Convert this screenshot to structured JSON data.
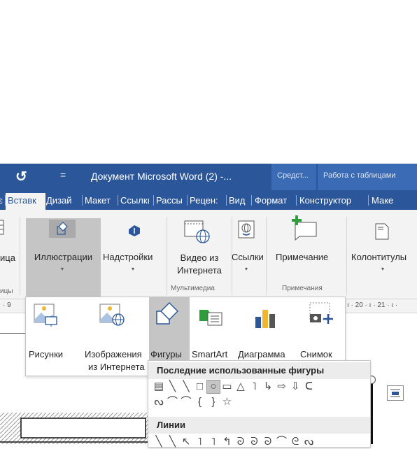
{
  "title_bar": {
    "undo_glyph": "↺",
    "qat_glyph": "=",
    "doc_title": "Документ Microsoft Word (2) -...",
    "ctx_tools": "Средст...",
    "ctx_tables": "Работа с таблицами"
  },
  "tabs": [
    {
      "label": "Вставк"
    },
    {
      "label": "Дизай"
    },
    {
      "label": "Макет"
    },
    {
      "label": "Ссылкı"
    },
    {
      "label": "Рассы"
    },
    {
      "label": "Рецен:"
    },
    {
      "label": "Вид"
    },
    {
      "label": "Формат"
    },
    {
      "label": "Конструктор"
    },
    {
      "label": "Маке"
    }
  ],
  "ribbon": {
    "table_partial": "ица",
    "table_group_partial": "ицы",
    "illustrations": "Иллюстрации",
    "addins": "Надстройки",
    "online_video_line1": "Видео из",
    "online_video_line2": "Интернета",
    "media_group": "Мультимедиа",
    "links": "Ссылки",
    "comment": "Примечание",
    "comments_group": "Примечания",
    "header_footer": "Колонтитулы",
    "chevron": "▾"
  },
  "ruler": {
    "left_text": "· 9",
    "right_text": "ı · 20 · ı · 21 · ı ·"
  },
  "illustrations_menu": {
    "pictures": "Рисунки",
    "online_pictures_line1": "Изображения",
    "online_pictures_line2": "из Интернета",
    "shapes": "Фигуры",
    "smartart": "SmartArt",
    "chart": "Диаграмма",
    "screenshot": "Снимок",
    "chevron": "▾"
  },
  "shapes_gallery": {
    "recent_header": "Последние использованные фигуры",
    "lines_header": "Линии",
    "recent_row1": [
      "▤",
      "╲",
      "╲",
      "□",
      "○",
      "▭",
      "△",
      "˥",
      "↳",
      "⇨",
      "⇩",
      "ᑕ"
    ],
    "recent_row2": [
      "ᔓ",
      "⌒",
      "⌒",
      "{",
      "}",
      "☆"
    ],
    "lines_row": [
      "╲",
      "╲",
      "↖",
      "˥",
      "˥",
      "↰",
      "ᘐ",
      "ᘐ",
      "ᘐ",
      "⌒",
      "ᘓ",
      "ᔓ"
    ]
  },
  "colors": {
    "accent": "#2b579a",
    "selected_button": "#c5c5c5",
    "ribbon_bg": "#f3f3f3"
  }
}
